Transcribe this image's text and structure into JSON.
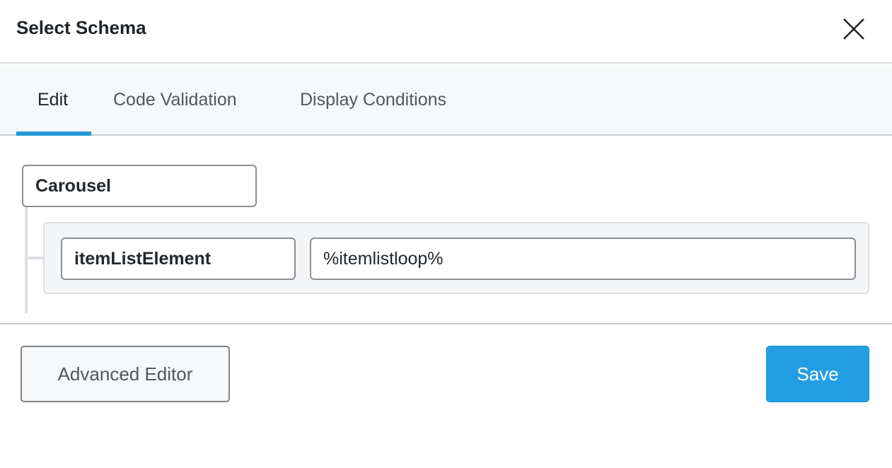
{
  "header": {
    "title": "Select Schema",
    "close_icon": "close-icon"
  },
  "tabs": [
    {
      "label": "Edit",
      "active": true
    },
    {
      "label": "Code Validation",
      "active": false
    },
    {
      "label": "Display Conditions",
      "active": false
    }
  ],
  "editor": {
    "root_type": "Carousel",
    "properties": [
      {
        "key": "itemListElement",
        "value": "%itemlistloop%"
      }
    ]
  },
  "footer": {
    "advanced_editor_label": "Advanced Editor",
    "save_label": "Save"
  },
  "colors": {
    "accent": "#2798d9",
    "save_button": "#239ee3"
  }
}
